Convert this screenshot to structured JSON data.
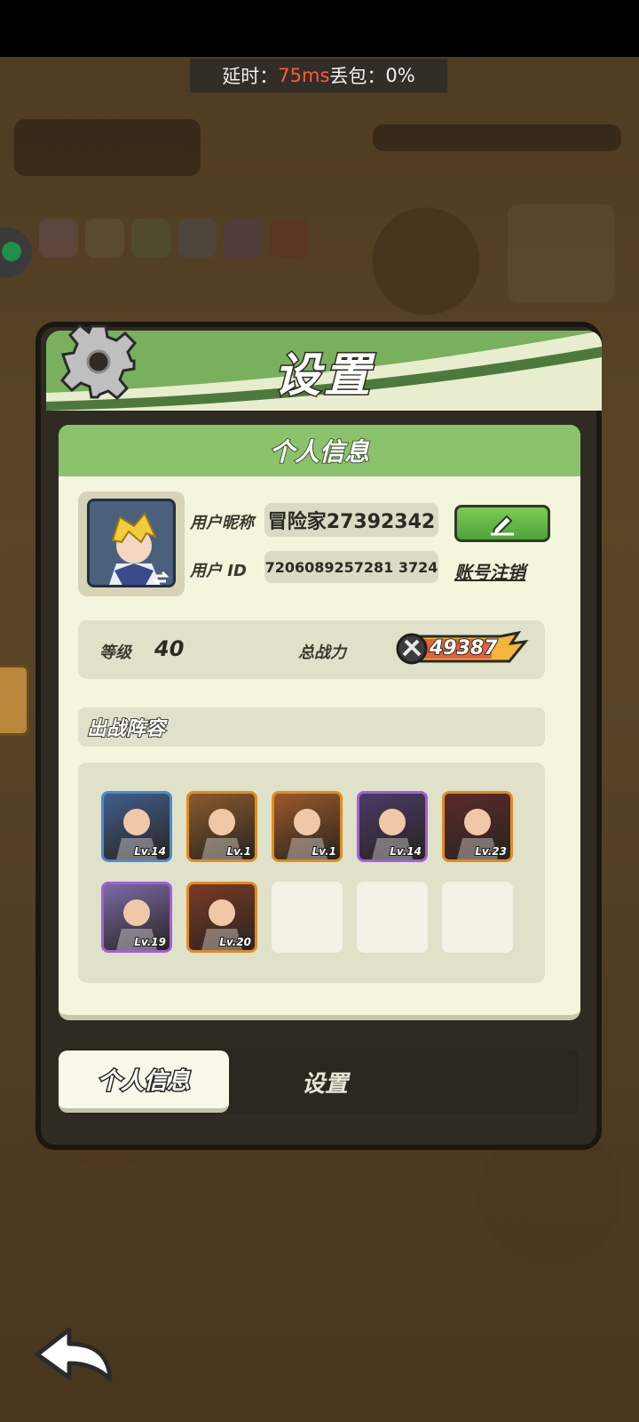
{
  "network": {
    "latency_label": "延时：",
    "latency_value": "75ms",
    "loss_label": "丢包：",
    "loss_value": "0%"
  },
  "dialog": {
    "title": "设置",
    "panel_title": "个人信息",
    "profile": {
      "nickname_label": "用户昵称",
      "nickname_value": "冒险家27392342",
      "id_label": "用户 ID",
      "id_value": "7206089257281 3724",
      "cancel_account": "账号注销"
    },
    "stats": {
      "level_label": "等级",
      "level_value": "40",
      "power_label": "总战力",
      "power_value": "49387"
    },
    "lineup": {
      "title": "出战阵容",
      "heroes": [
        {
          "level": "Lv.14",
          "color": "#3f5e8c",
          "border": "#4a8ad0"
        },
        {
          "level": "Lv.1",
          "color": "#8a5a2e",
          "border": "#e08c22"
        },
        {
          "level": "Lv.1",
          "color": "#9a5a2a",
          "border": "#e08c22"
        },
        {
          "level": "Lv.14",
          "color": "#4a3a66",
          "border": "#a060d8"
        },
        {
          "level": "Lv.23",
          "color": "#5a2a2a",
          "border": "#e08c22"
        },
        {
          "level": "Lv.19",
          "color": "#7a6aa8",
          "border": "#a060d8"
        },
        {
          "level": "Lv.20",
          "color": "#7a3a26",
          "border": "#e08c22"
        }
      ]
    },
    "tabs": {
      "profile": "个人信息",
      "settings": "设置"
    }
  },
  "colors": {
    "header_green": "#79b05d",
    "panel_bg": "#f4f5dd",
    "edit_button": "#5fb545",
    "latency_value": "#ff5a3c"
  }
}
